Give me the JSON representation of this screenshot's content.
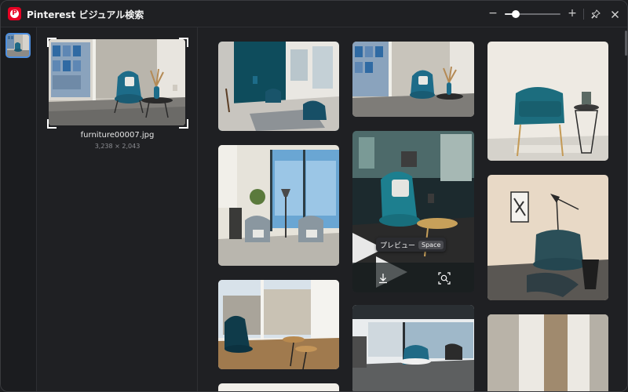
{
  "app": {
    "title": "Pinterest ビジュアル検索",
    "logo_letter": "P"
  },
  "toolbar": {
    "zoom_out_label": "−",
    "zoom_in_label": "+",
    "zoom_level": 0.2
  },
  "query": {
    "file_name": "furniture00007.jpg",
    "dimensions": "3,238 × 2,043"
  },
  "tooltip": {
    "label": "プレビュー",
    "shortcut": "Space"
  },
  "colors": {
    "accent": "#4d8fe0",
    "brand": "#e60023",
    "background": "#1f2023"
  },
  "icons": [
    "pinterest-logo-icon",
    "zoom-out-icon",
    "zoom-in-icon",
    "pin-icon",
    "close-icon",
    "download-icon",
    "visual-search-icon"
  ]
}
